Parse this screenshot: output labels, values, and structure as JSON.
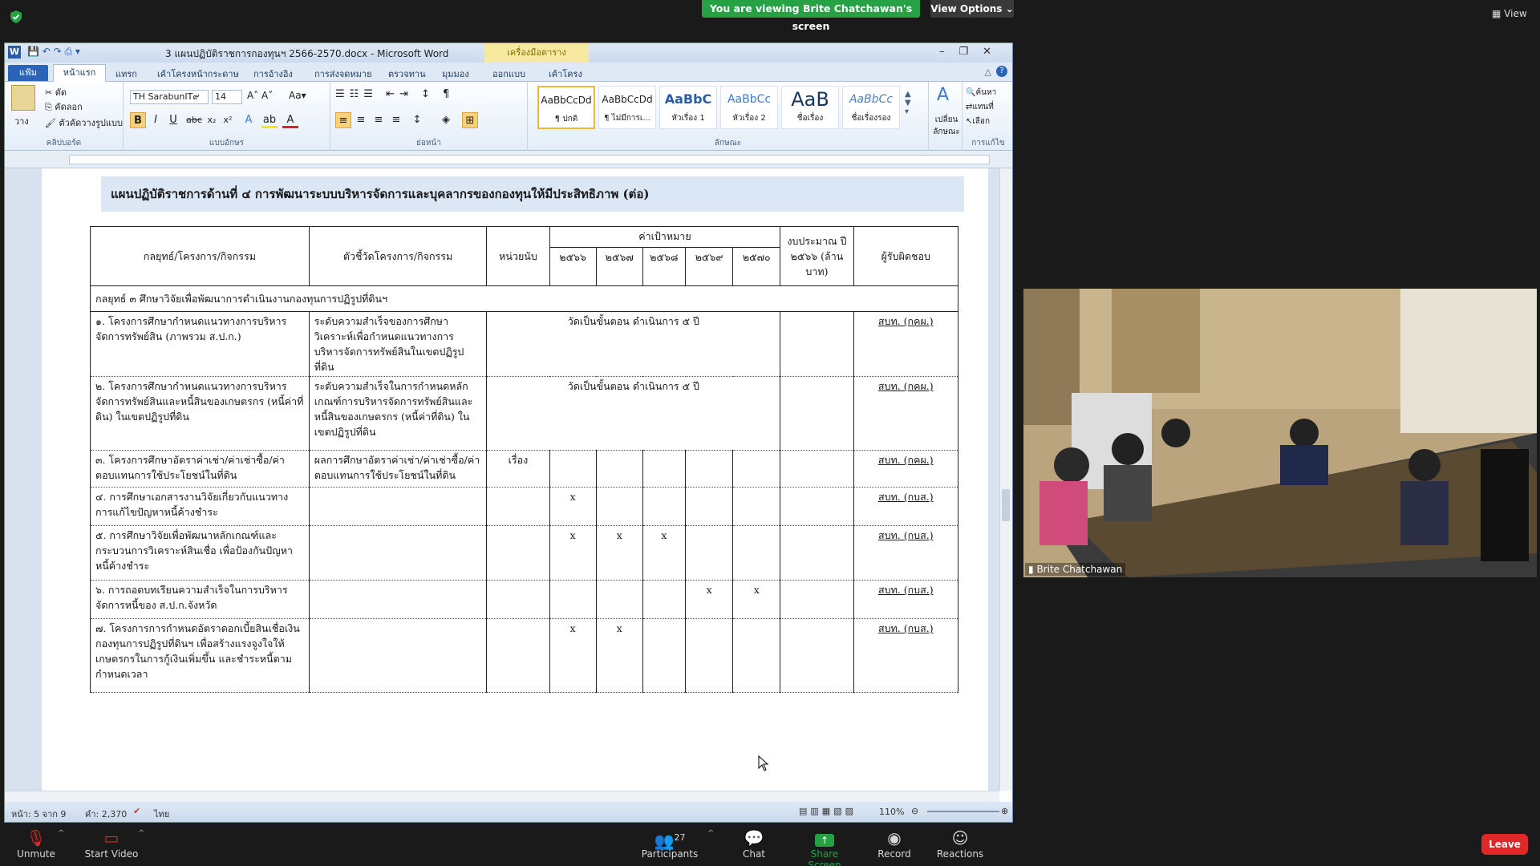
{
  "zoom": {
    "banner": "You are viewing Brite Chatchawan's screen",
    "view_options": "View Options",
    "view": "View",
    "participant_name": "Brite Chatchawan",
    "participants_count": "27",
    "buttons": {
      "unmute": "Unmute",
      "start_video": "Start Video",
      "participants": "Participants",
      "chat": "Chat",
      "share_screen": "Share Screen",
      "record": "Record",
      "reactions": "Reactions",
      "leave": "Leave"
    },
    "colors": {
      "banner": "#25a244",
      "leave": "#e02828",
      "share": "#25a244"
    }
  },
  "word": {
    "title": "3 แผนปฏิบัติราชการกองทุนฯ 2566-2570.docx - Microsoft Word",
    "context_tab": "เครื่องมือตาราง",
    "tabs": [
      "แฟ้ม",
      "หน้าแรก",
      "แทรก",
      "เค้าโครงหน้ากระดาษ",
      "การอ้างอิง",
      "การส่งจดหมาย",
      "ตรวจทาน",
      "มุมมอง",
      "ออกแบบ",
      "เค้าโครง"
    ],
    "ribbon": {
      "paste": "วาง",
      "cut": "ตัด",
      "copy": "คัดลอก",
      "format_painter": "ตัวคัดวางรูปแบบ",
      "clipboard": "คลิปบอร์ด",
      "font_name": "TH SarabunIT๙",
      "font_size": "14",
      "font_group": "แบบอักษร",
      "paragraph_group": "ย่อหน้า",
      "styles_group": "ลักษณะ",
      "editing_group": "การแก้ไข",
      "change_styles": "เปลี่ยน ลักษณะ",
      "find": "ค้นหา",
      "replace": "แทนที่",
      "select": "เลือก",
      "styles": [
        {
          "sample": "AaBbCcDd",
          "name": "¶ ปกติ"
        },
        {
          "sample": "AaBbCcDd",
          "name": "¶ ไม่มีการเ..."
        },
        {
          "sample": "AaBbC",
          "name": "หัวเรื่อง 1"
        },
        {
          "sample": "AaBbCc",
          "name": "หัวเรื่อง 2"
        },
        {
          "sample": "AaB",
          "name": "ชื่อเรื่อง"
        },
        {
          "sample": "AaBbCc",
          "name": "ชื่อเรื่องรอง"
        }
      ]
    },
    "status": {
      "page": "หน้า: 5 จาก 9",
      "words": "คำ: 2,370",
      "lang": "ไทย",
      "zoom": "110%"
    }
  },
  "document": {
    "heading": "แผนปฏิบัติราชการด้านที่ ๔ การพัฒนาระบบบริหารจัดการและบุคลากรของกองทุนให้มีประสิทธิภาพ (ต่อ)",
    "headers": {
      "strategy": "กลยุทธ์/โครงการ/กิจกรรม",
      "indicator": "ตัวชี้วัดโครงการ/กิจกรรม",
      "unit": "หน่วยนับ",
      "target": "ค่าเป้าหมาย",
      "years": [
        "๒๕๖๖",
        "๒๕๖๗",
        "๒๕๖๘",
        "๒๕๖๙",
        "๒๕๗๐"
      ],
      "budget": "งบประมาณ ปี ๒๕๖๖ (ล้านบาท)",
      "owner": "ผู้รับผิดชอบ"
    },
    "strategy_row": "กลยุทธ์ ๓ ศึกษาวิจัยเพื่อพัฒนาการดำเนินงานกองทุนการปฏิรูปที่ดินฯ",
    "rows": [
      {
        "project": "๑. โครงการศึกษากำหนดแนวทางการบริหารจัดการทรัพย์สิน (ภาพรวม ส.ป.ก.)",
        "indicator": "ระดับความสำเร็จของการศึกษาวิเคราะห์เพื่อกำหนดแนวทางการบริหารจัดการทรัพย์สินในเขตปฏิรูปที่ดิน",
        "unit": "",
        "target_text": "วัดเป็นขั้นตอน ดำเนินการ ๕ ปี",
        "owner": "สบท. (กคผ.)"
      },
      {
        "project": "๒. โครงการศึกษากำหนดแนวทางการบริหารจัดการทรัพย์สินและหนี้สินของเกษตรกร (หนี้ค่าที่ดิน) ในเขตปฏิรูปที่ดิน",
        "indicator": "ระดับความสำเร็จในการกำหนดหลักเกณฑ์การบริหารจัดการทรัพย์สินและหนี้สินของเกษตรกร (หนี้ค่าที่ดิน) ในเขตปฏิรูปที่ดิน",
        "unit": "",
        "target_text": "วัดเป็นขั้นตอน ดำเนินการ ๕ ปี",
        "owner": "สบท. (กคผ.)"
      },
      {
        "project": "๓. โครงการศึกษาอัตราค่าเช่า/ค่าเช่าซื้อ/ค่าตอบแทนการใช้ประโยชน์ในที่ดิน",
        "indicator": "ผลการศึกษาอัตราค่าเช่า/ค่าเช่าซื้อ/ค่าตอบแทนการใช้ประโยชน์ในที่ดิน",
        "unit": "เรื่อง",
        "marks": [
          "",
          "",
          "",
          "",
          ""
        ],
        "owner": "สบท. (กคผ.)"
      },
      {
        "project": "๔. การศึกษาเอกสารงานวิจัยเกี่ยวกับแนวทางการแก้ไขปัญหาหนี้ค้างชำระ",
        "indicator": "",
        "unit": "",
        "marks": [
          "x",
          "",
          "",
          "",
          ""
        ],
        "owner": "สบท. (กบส.)"
      },
      {
        "project": "๕. การศึกษาวิจัยเพื่อพัฒนาหลักเกณฑ์และกระบวนการวิเคราะห์สินเชื่อ เพื่อป้องกันปัญหาหนี้ค้างชำระ",
        "indicator": "",
        "unit": "",
        "marks": [
          "x",
          "x",
          "x",
          "",
          ""
        ],
        "owner": "สบท. (กบส.)"
      },
      {
        "project": "๖. การถอดบทเรียนความสำเร็จในการบริหารจัดการหนี้ของ ส.ป.ก.จังหวัด",
        "indicator": "",
        "unit": "",
        "marks": [
          "",
          "",
          "",
          "x",
          "x"
        ],
        "owner": "สบท. (กบส.)"
      },
      {
        "project": "๗. โครงการการกำหนดอัตราดอกเบี้ยสินเชื่อเงินกองทุนการปฏิรูปที่ดินฯ เพื่อสร้างแรงจูงใจให้เกษตรกรในการกู้เงินเพิ่มขึ้น และชำระหนี้ตามกำหนดเวลา",
        "indicator": "",
        "unit": "",
        "marks": [
          "x",
          "x",
          "",
          "",
          ""
        ],
        "owner": "สบท. (กบส.)"
      }
    ]
  }
}
